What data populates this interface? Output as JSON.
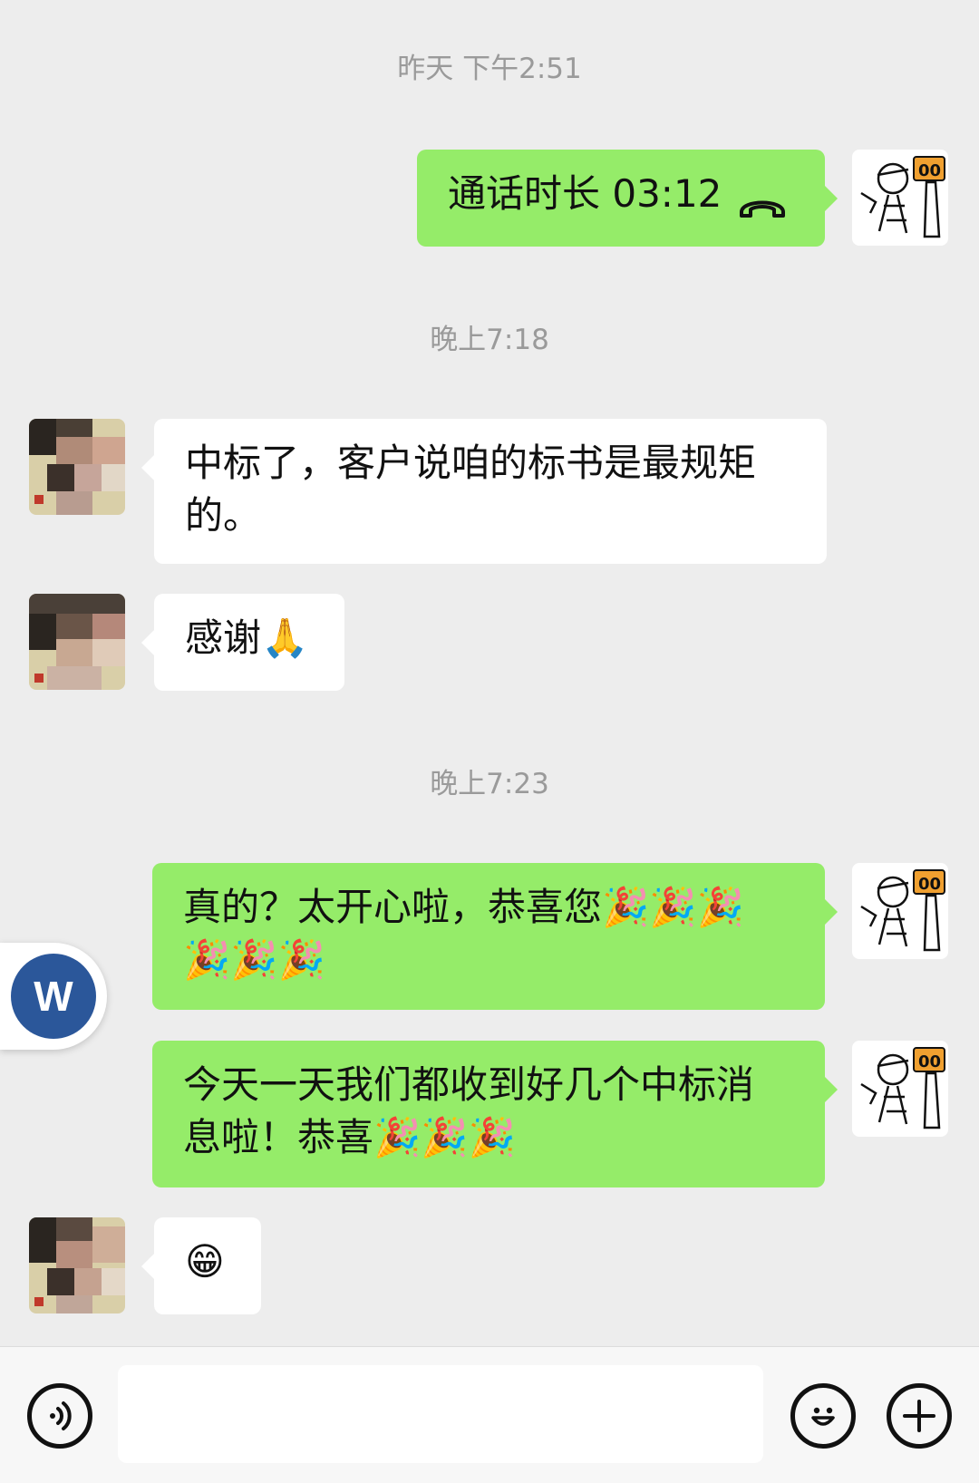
{
  "timestamps": {
    "t1": "昨天 下午2:51",
    "t2": "晚上7:18",
    "t3": "晚上7:23"
  },
  "messages": {
    "call": {
      "label": "通话时长 03:12",
      "icon": "hangup-phone-icon"
    },
    "m1": "中标了，客户说咱的标书是最规矩的。",
    "m2_text": "感谢",
    "m2_emoji": "🙏",
    "m3_line1": "真的？太开心啦，恭喜您🎉🎉🎉",
    "m3_line2": "🎉🎉🎉",
    "m4_line1": "今天一天我们都收到好几个中标消",
    "m4_line2": "息啦！恭喜🎉🎉🎉",
    "m5_emoji": "😁"
  },
  "floating_app": {
    "letter": "W",
    "color": "#2b579a"
  },
  "input_bar": {
    "voice_icon": "voice-icon",
    "emoji_icon": "emoji-smile-icon",
    "plus_icon": "plus-icon",
    "value": ""
  },
  "colors": {
    "sent_bubble": "#95ec69",
    "received_bubble": "#ffffff",
    "background": "#ededed"
  }
}
